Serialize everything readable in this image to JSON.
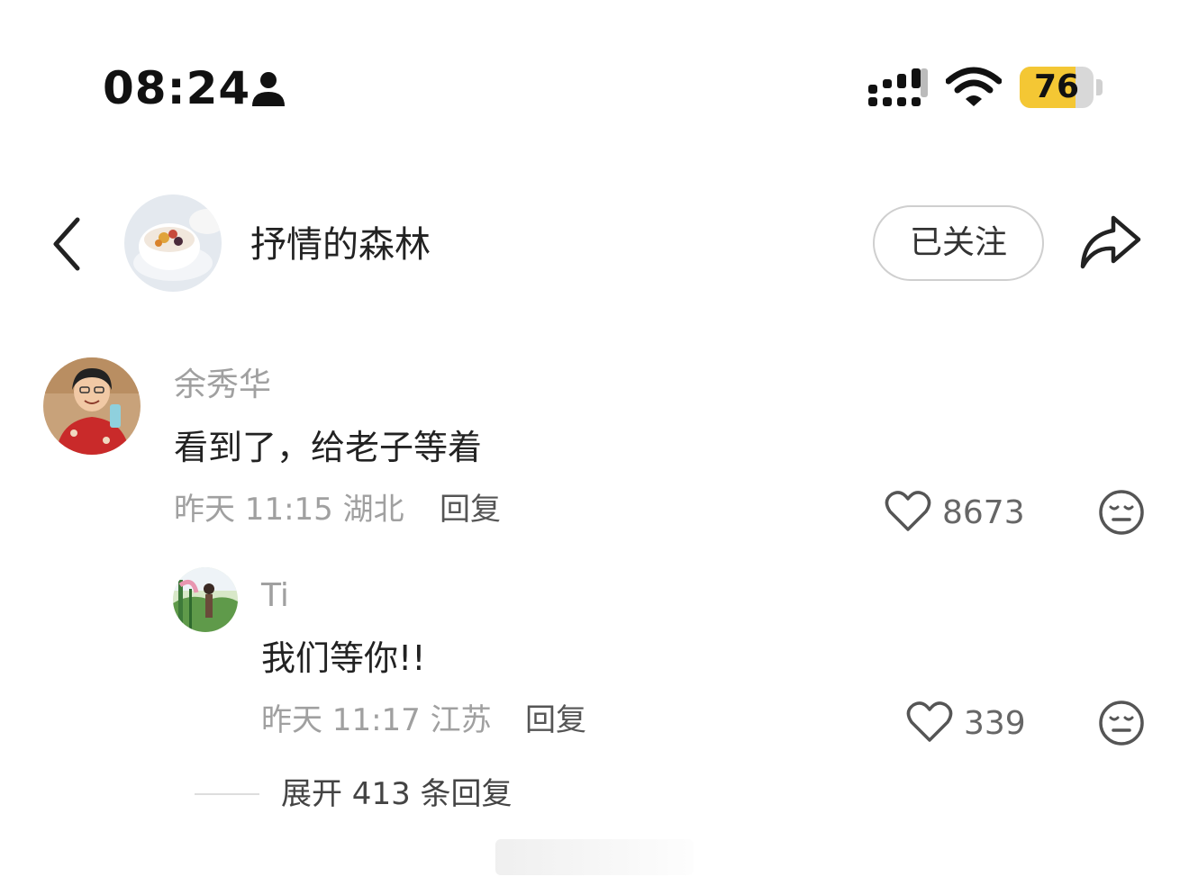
{
  "status_bar": {
    "time": "08:24",
    "battery_level": "76",
    "battery_fraction": 0.76,
    "battery_color": "#f4c734",
    "icons": [
      "person-icon",
      "signal-icon",
      "wifi-icon",
      "battery-icon"
    ]
  },
  "header": {
    "back_icon": "chevron-left-icon",
    "account_name": "抒情的森林",
    "follow_label": "已关注",
    "share_icon": "share-arrow-icon"
  },
  "comments": [
    {
      "user": "余秀华",
      "text": "看到了，给老子等着",
      "meta": "昨天 11:15 湖北",
      "reply_label": "回复",
      "likes": "8673",
      "replies": [
        {
          "user": "Ti",
          "text": "我们等你!!",
          "meta": "昨天 11:17 江苏",
          "reply_label": "回复",
          "likes": "339"
        }
      ]
    }
  ],
  "expand_replies": "展开 413 条回复"
}
